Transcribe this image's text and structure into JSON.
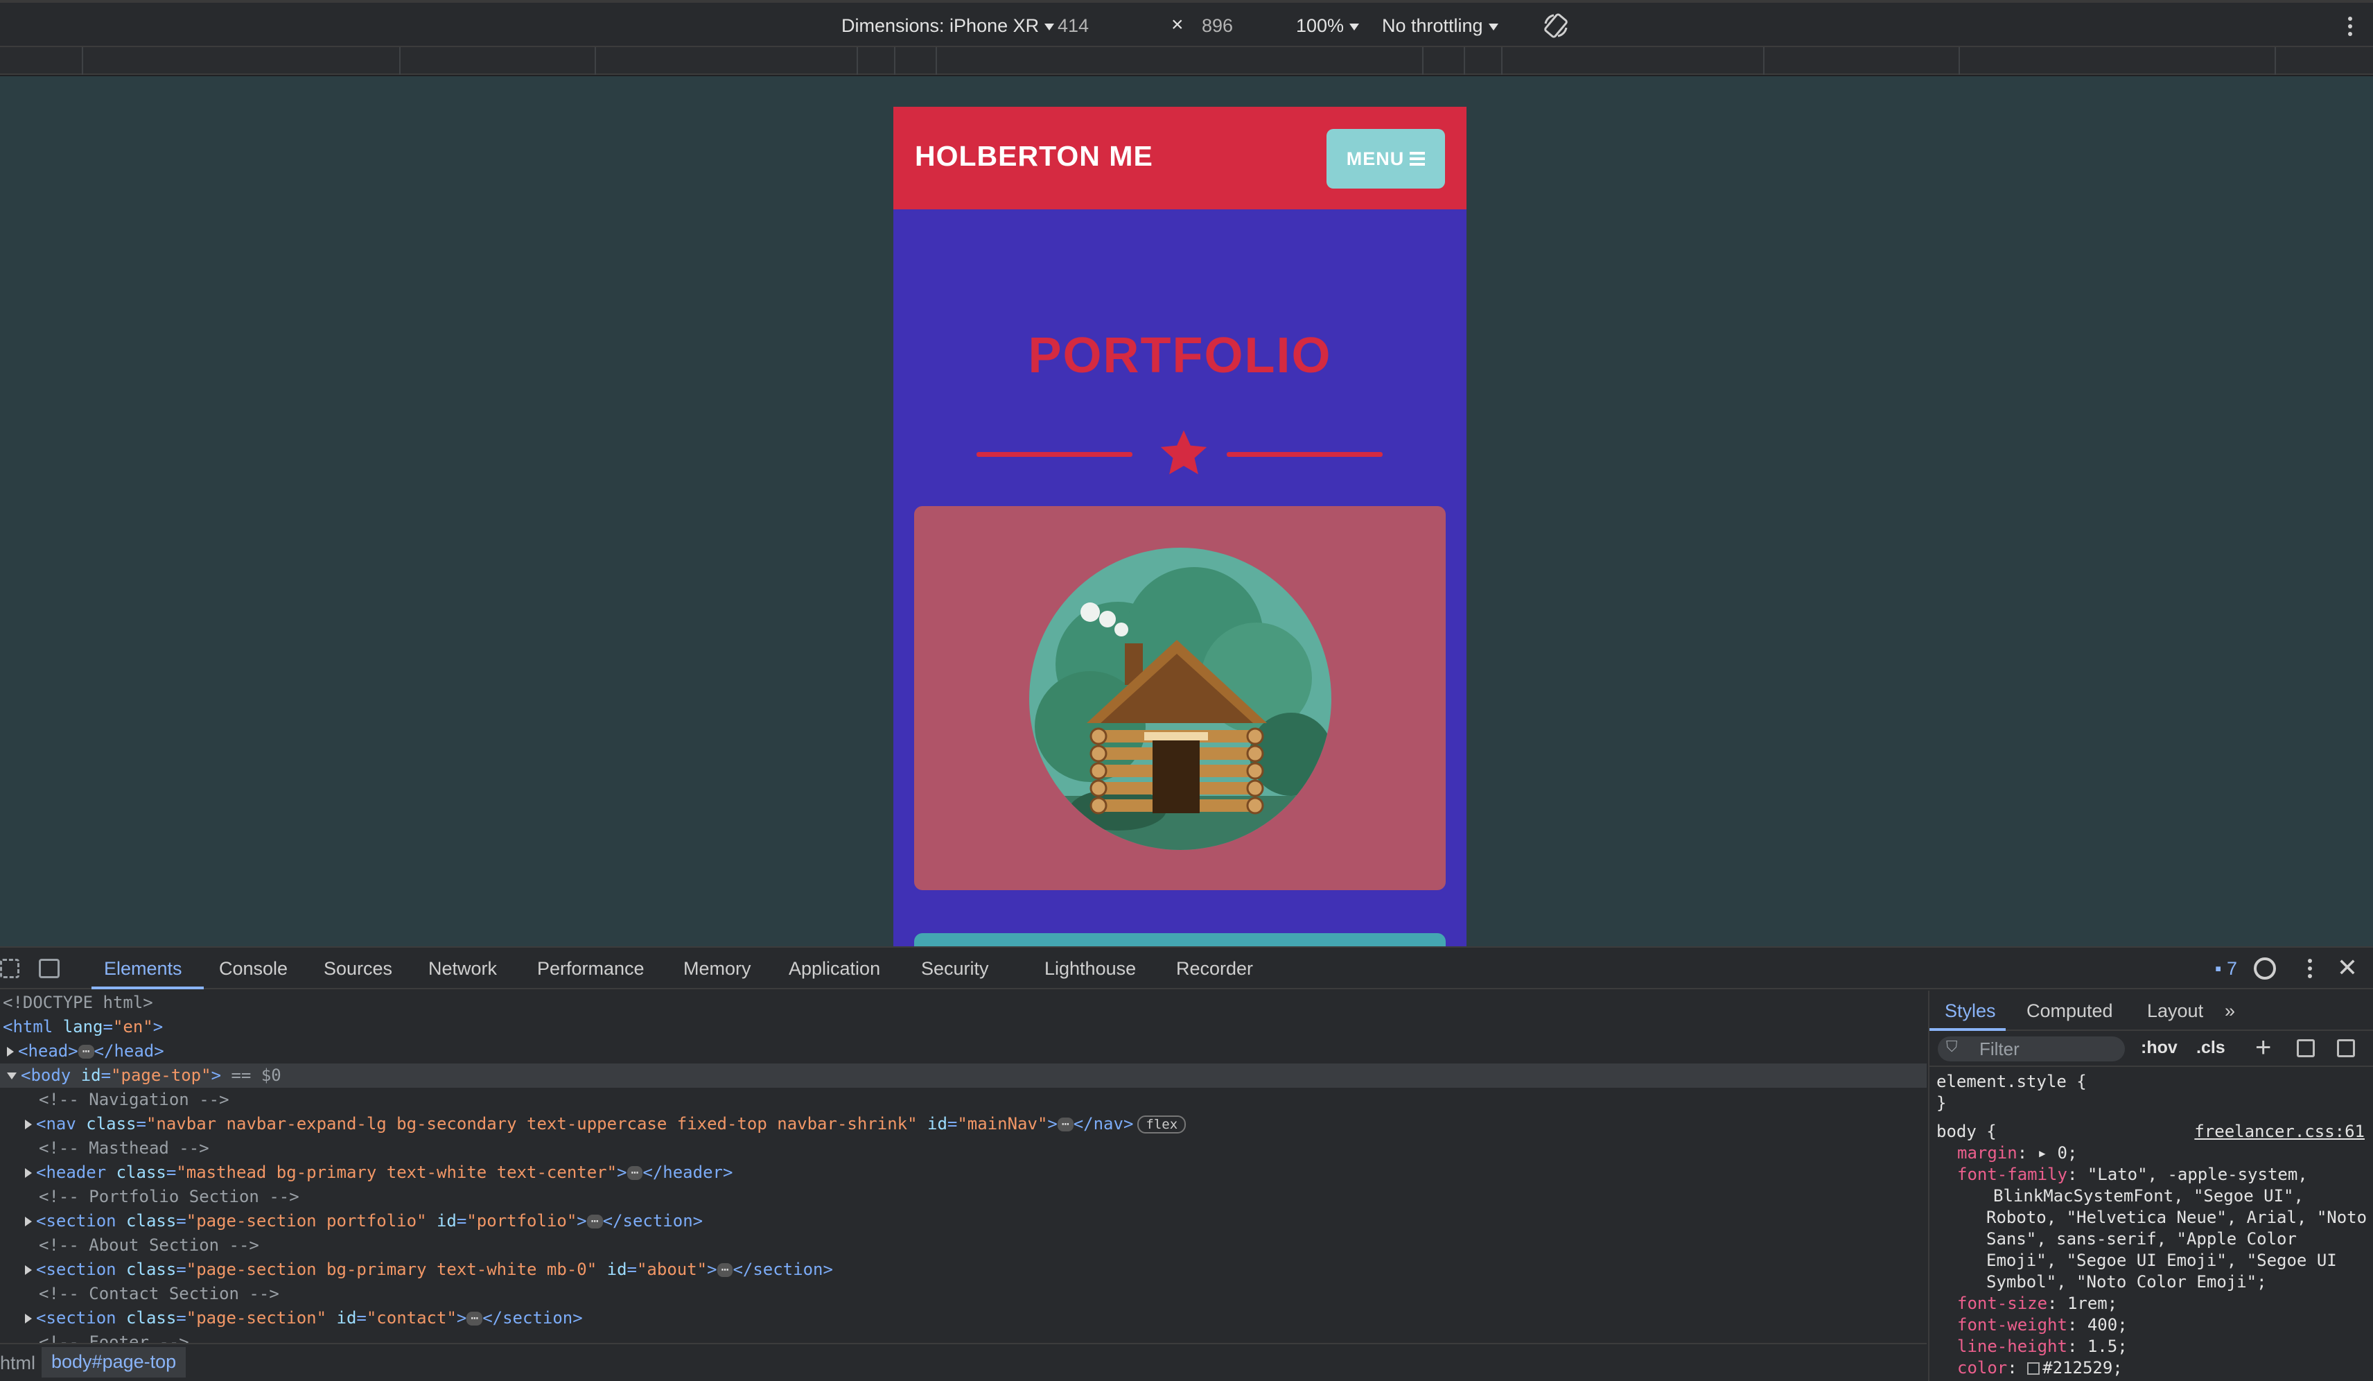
{
  "device_toolbar": {
    "dimensions_label": "Dimensions: iPhone XR",
    "width": "414",
    "times": "×",
    "height": "896",
    "zoom": "100%",
    "throttling": "No throttling"
  },
  "page": {
    "brand": "HOLBERTON ME",
    "menu_label": "MENU",
    "section_title": "PORTFOLIO"
  },
  "colors": {
    "navbar": "#d52a41",
    "primary": "#4031b5",
    "menu_button": "#8ad1d3",
    "card": "#b05468"
  },
  "devtools": {
    "tabs": [
      "Elements",
      "Console",
      "Sources",
      "Network",
      "Performance",
      "Memory",
      "Application",
      "Security",
      "Lighthouse",
      "Recorder"
    ],
    "issues_count": "7",
    "dom_lines": {
      "doctype": "<!DOCTYPE html>",
      "html_open": "<html",
      "html_attr": "lang",
      "html_val": "\"en\"",
      "head": "<head>",
      "head_close": "</head>",
      "body_open": "<body",
      "body_attr": "id",
      "body_val": "\"page-top\"",
      "body_eq": "== $0",
      "cmt_nav": "<!-- Navigation -->",
      "nav_open": "<nav",
      "nav_class_attr": "class",
      "nav_class_val": "\"navbar navbar-expand-lg bg-secondary text-uppercase fixed-top navbar-shrink\"",
      "nav_id_attr": "id",
      "nav_id_val": "\"mainNav\"",
      "nav_close": "</nav>",
      "flex_badge": "flex",
      "cmt_masthead": "<!-- Masthead -->",
      "header_open": "<header",
      "header_class_val": "\"masthead bg-primary text-white text-center\"",
      "header_close": "</header>",
      "cmt_portfolio": "<!-- Portfolio Section -->",
      "section_open": "<section",
      "portfolio_class_val": "\"page-section portfolio\"",
      "portfolio_id_val": "\"portfolio\"",
      "section_close": "</section>",
      "cmt_about": "<!-- About Section -->",
      "about_class_val": "\"page-section bg-primary text-white mb-0\"",
      "about_id_val": "\"about\"",
      "cmt_contact": "<!-- Contact Section -->",
      "contact_class_val": "\"page-section\"",
      "contact_id_val": "\"contact\"",
      "cmt_footer": "<!-- Footer -->"
    },
    "breadcrumb": [
      "html",
      "body#page-top"
    ],
    "styles_tabs": [
      "Styles",
      "Computed",
      "Layout"
    ],
    "filter_placeholder": "Filter",
    "hov": ":hov",
    "cls": ".cls",
    "element_style": "element.style {",
    "close_brace": "}",
    "body_selector": "body {",
    "body_source": "freelancer.css:61",
    "props": {
      "margin_name": "margin",
      "margin_val": "0;",
      "font_family_name": "font-family",
      "font_family_l1": "\"Lato\", -apple-system,",
      "font_family_l2": "BlinkMacSystemFont, \"Segoe UI\",",
      "font_family_l3": "Roboto, \"Helvetica Neue\", Arial, \"Noto",
      "font_family_l4": "Sans\", sans-serif, \"Apple Color",
      "font_family_l5": "Emoji\", \"Segoe UI Emoji\", \"Segoe UI",
      "font_family_l6": "Symbol\", \"Noto Color Emoji\";",
      "font_size_name": "font-size",
      "font_size_val": "1rem;",
      "font_weight_name": "font-weight",
      "font_weight_val": "400;",
      "line_height_name": "line-height",
      "line_height_val": "1.5;",
      "color_name": "color",
      "color_val": "#212529;"
    }
  }
}
